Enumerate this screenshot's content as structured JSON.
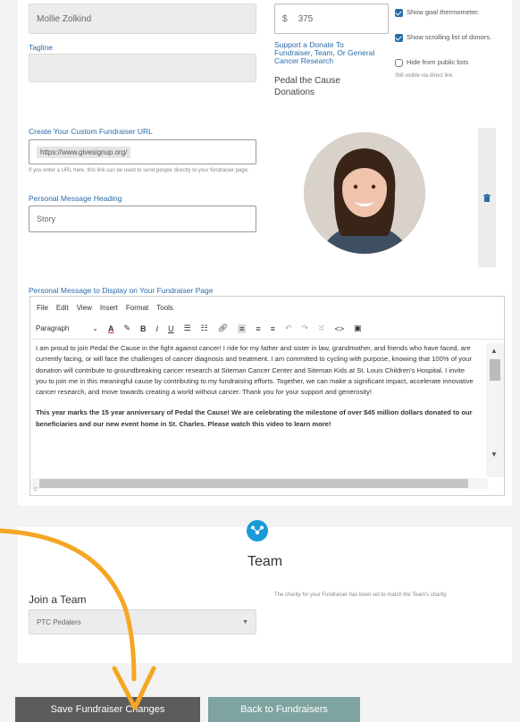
{
  "fields": {
    "name_value": "Mollie Zolkind",
    "tagline_label": "Tagline",
    "tagline_value": "",
    "goal_currency": "$",
    "goal_value": "375",
    "support_label": "Support a Donate To Fundraiser, Team, Or General Cancer Research",
    "support_value": "Pedal the Cause Donations",
    "url_label": "Create Your Custom Fundraiser URL",
    "url_value": "https://www.givesignup.org/",
    "url_help": "If you enter a URL here, this link can be used to send people directly to your fundraiser page.",
    "heading_label": "Personal Message Heading",
    "heading_value": "Story",
    "message_label": "Personal Message to Display on Your Fundraiser Page"
  },
  "options": {
    "thermometer": "Show goal thermometer.",
    "donors": "Show scrolling list of donors.",
    "hide": "Hide from public lists",
    "hide_note": "Still visible via direct link."
  },
  "editor": {
    "menu": [
      "File",
      "Edit",
      "View",
      "Insert",
      "Format",
      "Tools"
    ],
    "format_select": "Paragraph",
    "para1": "I am proud to join Pedal the Cause in the fight against cancer! I ride for my father and sister in law, grandmother, and friends who have faced, are currently facing, or will face the challenges of cancer diagnosis and treatment. I am committed to cycling with purpose, knowing that 100% of your donation will contribute to groundbreaking cancer research at Siteman Cancer Center and Siteman Kids at St. Louis Children's Hospital. I invite you to join me in this meaningful cause by contributing to my fundraising efforts. Together, we can make a significant impact, accelerate innovative cancer research, and move towards creating a world without cancer. Thank you for your support and generosity!",
    "para2": "This year marks the 15 year anniversary of Pedal the Cause! We are celebrating the milestone of over $45 million dollars donated to our beneficiaries and our new event home in St. Charles. Please watch this video to learn more!",
    "status": "p"
  },
  "team": {
    "title": "Team",
    "join_label": "Join a Team",
    "selected": "PTC Pedalers",
    "note": "The charity for your Fundraiser has been set to match the Team's charity."
  },
  "buttons": {
    "save": "Save Fundraiser Changes",
    "back": "Back to Fundraisers"
  },
  "colors": {
    "link_blue": "#2a6ca8",
    "team_icon": "#1a9ad6",
    "save_bg": "#5c5c5c",
    "back_bg": "#7fa3a0",
    "arrow": "#f5a623"
  }
}
